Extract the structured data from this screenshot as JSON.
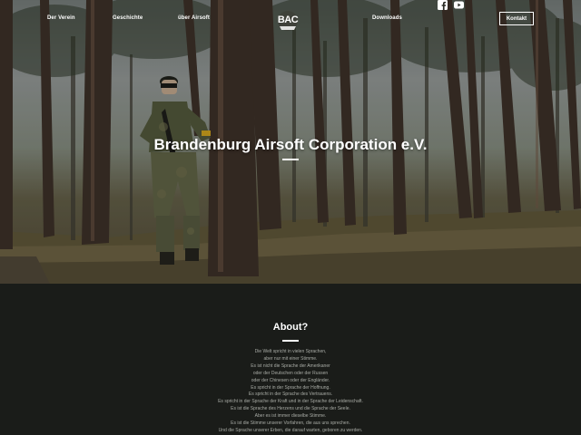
{
  "nav": {
    "links": [
      "Der Verein",
      "Geschichte",
      "über Airsoft",
      "Downloads"
    ],
    "logo_text": "BAC",
    "contact_label": "Kontakt",
    "social_icons": [
      "facebook-icon",
      "youtube-icon"
    ]
  },
  "hero": {
    "title": "Brandenburg Airsoft Corporation e.V."
  },
  "about": {
    "title": "About?",
    "lines": [
      "Die Welt spricht in vielen Sprachen,",
      "aber nur mit einer Stimme.",
      "Es ist nicht die Sprache der Amerikaner",
      "oder der Deutschen oder der Russen",
      "oder der Chinesen oder der Engländer.",
      "Es spricht in der Sprache der Hoffnung.",
      "Es spricht in der Sprache des Vertrauens.",
      "Es spricht in der Sprache der Kraft und in der Sprache der Leidenschaft.",
      "Es ist die Sprache des Herzens und die Sprache der Seele.",
      "Aber es ist immer dieselbe Stimme.",
      "Es ist die Stimme unserer Vorfahren, die aus uns sprechen.",
      "Und die Sprache unserer Erben, die darauf warten, geboren zu werden."
    ]
  },
  "colors": {
    "dark_background": "#1a1c19",
    "body_text": "#a9aca6",
    "white": "#ffffff"
  }
}
